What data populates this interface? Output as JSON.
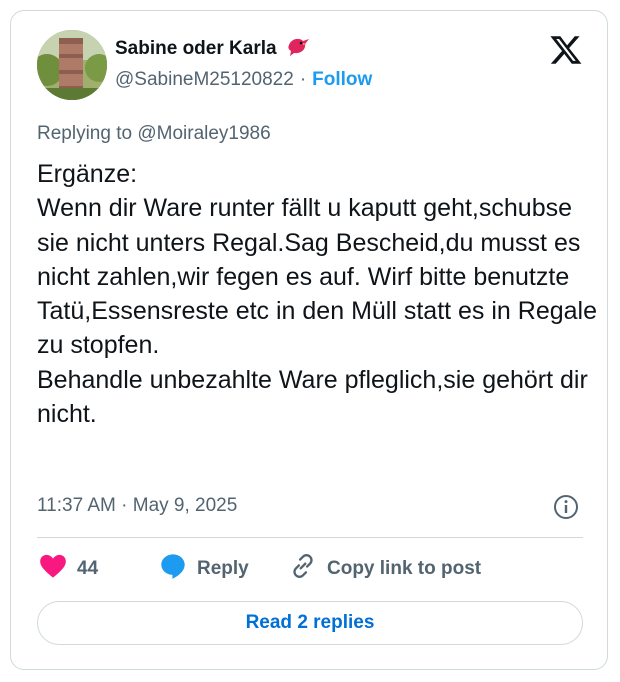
{
  "author": {
    "display_name": "Sabine oder Karla",
    "name_emoji_icon": "red-bird-icon",
    "handle": "@SabineM25120822",
    "separator": "·",
    "follow_label": "Follow"
  },
  "brand_icon": "x-logo-icon",
  "replying_to": "Replying to @Moiraley1986",
  "tweet_text": "Ergänze:\nWenn dir Ware runter fällt u kaputt geht,schubse sie nicht unters Regal.Sag Bescheid,du musst es nicht zahlen,wir fegen es auf. Wirf bitte benutzte Tatü,Essensreste etc in den Müll statt es in Regale zu stopfen.\nBehandle unbezahlte Ware pfleglich,sie gehört dir nicht.",
  "timestamp": "11:37 AM · May 9, 2025",
  "actions": {
    "like_count": "44",
    "reply_label": "Reply",
    "copy_label": "Copy link to post"
  },
  "read_replies_label": "Read 2 replies",
  "colors": {
    "like": "#f91880",
    "reply": "#1d9bf0",
    "link": "#006fd6",
    "secondary_text": "#536471"
  }
}
